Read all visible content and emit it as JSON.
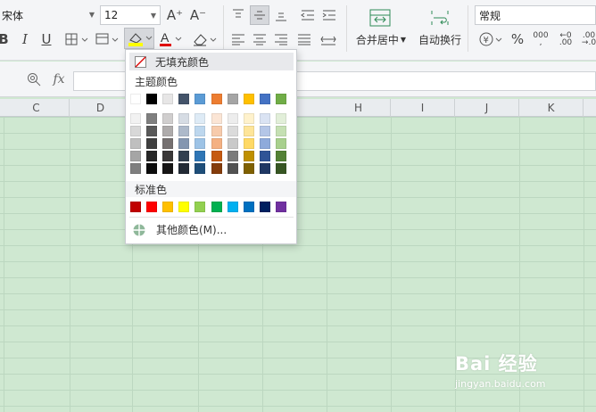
{
  "font": {
    "name": "宋体",
    "size": "12",
    "grow": "A⁺",
    "shrink": "A⁻"
  },
  "fill_menu": {
    "no_fill": "无填充颜色",
    "theme_title": "主题颜色",
    "standard_title": "标准色",
    "more": "其他颜色(M)..."
  },
  "merge_label": "合并居中",
  "wrap_label": "自动换行",
  "number_format": "常规",
  "formula_fx": "fx",
  "columns": [
    "C",
    "D",
    "H",
    "I",
    "J",
    "K"
  ],
  "theme_top": [
    "#ffffff",
    "#000000",
    "#e7e6e6",
    "#44546a",
    "#5b9bd5",
    "#ed7d31",
    "#a5a5a5",
    "#ffc000",
    "#4472c4",
    "#70ad47"
  ],
  "theme_shades": [
    [
      "#f2f2f2",
      "#7f7f7f",
      "#d0cece",
      "#d6dce4",
      "#deebf6",
      "#fbe5d5",
      "#ededed",
      "#fff2cc",
      "#dae3f3",
      "#e2efd9"
    ],
    [
      "#d8d8d8",
      "#595959",
      "#aeabab",
      "#adb9ca",
      "#bdd7ee",
      "#f7cbac",
      "#dbdbdb",
      "#fee599",
      "#b4c6e7",
      "#c5e0b3"
    ],
    [
      "#bfbfbf",
      "#3f3f3f",
      "#757070",
      "#8496b0",
      "#9dc3e6",
      "#f4b183",
      "#c9c9c9",
      "#ffd965",
      "#8eaadb",
      "#a8d08d"
    ],
    [
      "#a5a5a5",
      "#262626",
      "#3a3838",
      "#323f4f",
      "#2e75b5",
      "#c55a11",
      "#7b7b7b",
      "#bf9000",
      "#2f5496",
      "#538135"
    ],
    [
      "#7f7f7f",
      "#0c0c0c",
      "#171616",
      "#222a35",
      "#1e4e79",
      "#843c0b",
      "#525252",
      "#7f6000",
      "#1f3864",
      "#375623"
    ]
  ],
  "standard": [
    "#c00000",
    "#ff0000",
    "#ffc000",
    "#ffff00",
    "#92d050",
    "#00b050",
    "#00b0f0",
    "#0070c0",
    "#002060",
    "#7030a0"
  ],
  "watermark": {
    "brand": "Bai 经验",
    "url": "jingyan.baidu.com"
  }
}
